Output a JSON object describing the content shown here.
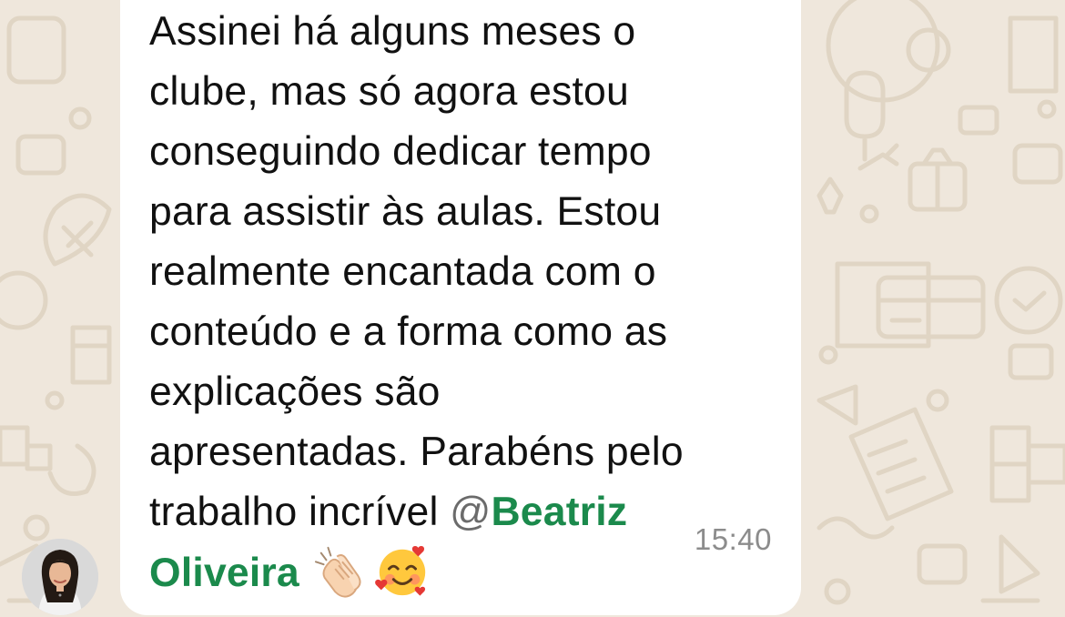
{
  "chat": {
    "message": {
      "lines": [
        "Assinei há alguns meses o",
        "clube, mas só agora estou",
        "conseguindo dedicar tempo",
        "para assistir às aulas. Estou",
        "realmente encantada com o",
        "conteúdo e a forma como as",
        "explicações são",
        "apresentadas. Parabéns pelo"
      ],
      "line9_prefix": "trabalho incrível ",
      "mention_at": "@",
      "mention_first": "Beatriz",
      "mention_last": "Oliveira",
      "emojis": [
        "clapping-hands-emoji",
        "smiling-face-with-hearts-emoji"
      ],
      "timestamp": "15:40"
    },
    "sender": {
      "avatar_icon": "sender-avatar"
    }
  },
  "colors": {
    "wallpaper": "#efe7dc",
    "bubble": "#ffffff",
    "mention": "#1b8a4c",
    "text": "#111111",
    "timestamp": "#8c8c8c"
  }
}
